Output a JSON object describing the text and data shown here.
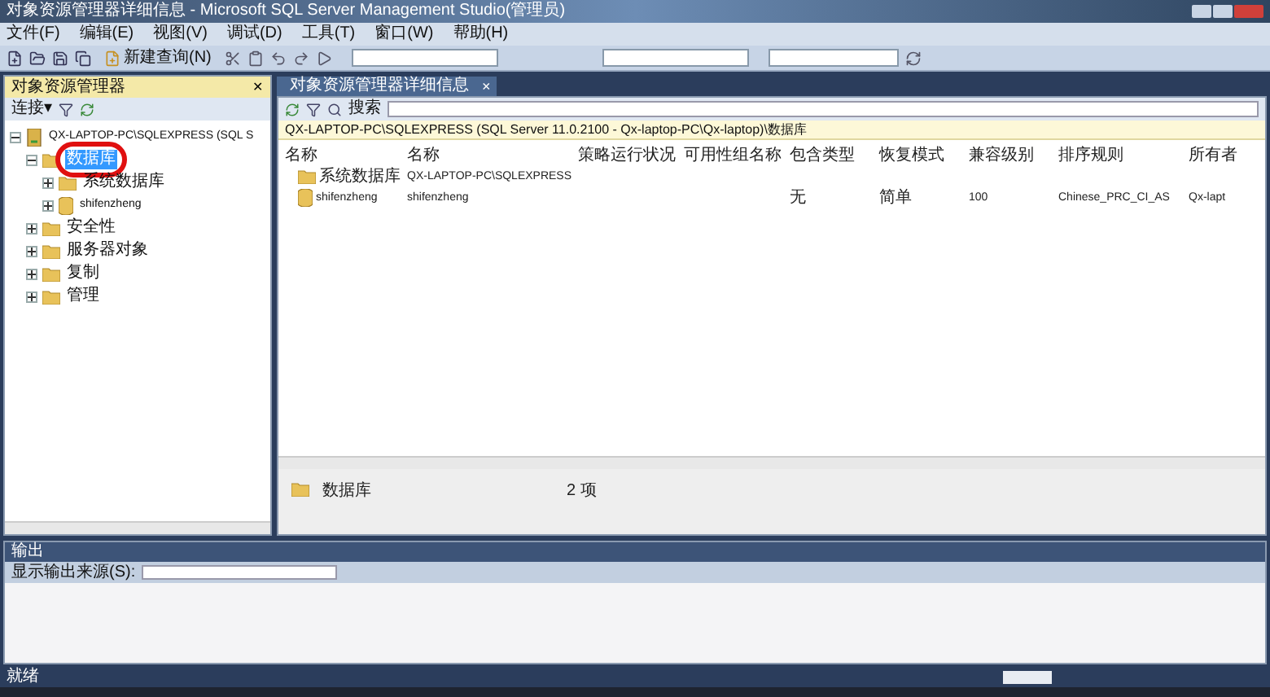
{
  "window": {
    "title": "对象资源管理器详细信息 - Microsoft SQL Server Management Studio(管理员)"
  },
  "menu": [
    "文件(F)",
    "编辑(E)",
    "视图(V)",
    "调试(D)",
    "工具(T)",
    "窗口(W)",
    "帮助(H)"
  ],
  "toolbar": {
    "new_query": "新建查询(N)"
  },
  "object_explorer": {
    "title": "对象资源管理器",
    "close": "✕",
    "connect": "连接▾",
    "tree": [
      {
        "label": "QX-LAPTOP-PC\\SQLEXPRESS (SQL S",
        "kind": "server",
        "expanded": true,
        "selected": false,
        "children": [
          {
            "label": "数据库",
            "kind": "folder",
            "expanded": true,
            "selected": true,
            "children": [
              {
                "label": "系统数据库",
                "kind": "folder",
                "expanded": false,
                "selected": false
              },
              {
                "label": "shifenzheng",
                "kind": "database",
                "expanded": false,
                "selected": false
              }
            ]
          },
          {
            "label": "安全性",
            "kind": "folder",
            "expanded": false,
            "selected": false
          },
          {
            "label": "服务器对象",
            "kind": "folder",
            "expanded": false,
            "selected": false
          },
          {
            "label": "复制",
            "kind": "folder",
            "expanded": false,
            "selected": false
          },
          {
            "label": "管理",
            "kind": "folder",
            "expanded": false,
            "selected": false
          }
        ]
      }
    ]
  },
  "details": {
    "tab": "对象资源管理器详细信息",
    "tab_close": "×",
    "search_label": "搜索",
    "path": "QX-LAPTOP-PC\\SQLEXPRESS (SQL Server 11.0.2100 - Qx-laptop-PC\\Qx-laptop)\\数据库",
    "columns": [
      "名称",
      "名称",
      "策略运行状况",
      "可用性组名称",
      "包含类型",
      "恢复模式",
      "兼容级别",
      "排序规则",
      "所有者"
    ],
    "rows": [
      {
        "kind": "folder",
        "cells": [
          "系统数据库",
          "QX-LAPTOP-PC\\SQLEXPRESS",
          "",
          "",
          "",
          "",
          "",
          "",
          ""
        ]
      },
      {
        "kind": "database",
        "cells": [
          "shifenzheng",
          "shifenzheng",
          "",
          "",
          "无",
          "简单",
          "100",
          "Chinese_PRC_CI_AS",
          "Qx-lapt"
        ]
      }
    ],
    "footer": {
      "label": "数据库",
      "count": "2 项"
    }
  },
  "output": {
    "title": "输出",
    "source_label": "显示输出来源(S):"
  },
  "status_bar": {
    "text": "就绪"
  }
}
